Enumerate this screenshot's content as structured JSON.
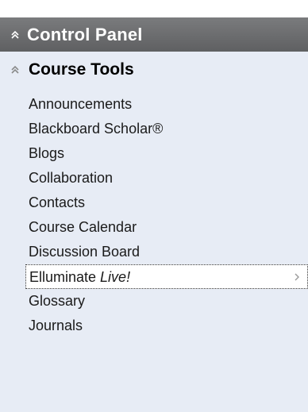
{
  "control_panel": {
    "title": "Control Panel",
    "collapse_icon": "double-chevron-up-icon",
    "header_color": "#6d6e70"
  },
  "course_tools": {
    "title": "Course Tools",
    "collapse_icon": "double-chevron-up-icon",
    "background_color": "#e7ecf5",
    "items": [
      {
        "label": "Announcements"
      },
      {
        "label": "Blackboard Scholar®"
      },
      {
        "label": "Blogs"
      },
      {
        "label": "Collaboration"
      },
      {
        "label": "Contacts"
      },
      {
        "label": "Course Calendar"
      },
      {
        "label": "Discussion Board"
      },
      {
        "label": "Elluminate",
        "label_suffix": "Live!",
        "selected": true,
        "submenu_icon": "chevron-right-icon"
      },
      {
        "label": "Glossary"
      },
      {
        "label": "Journals"
      }
    ]
  }
}
